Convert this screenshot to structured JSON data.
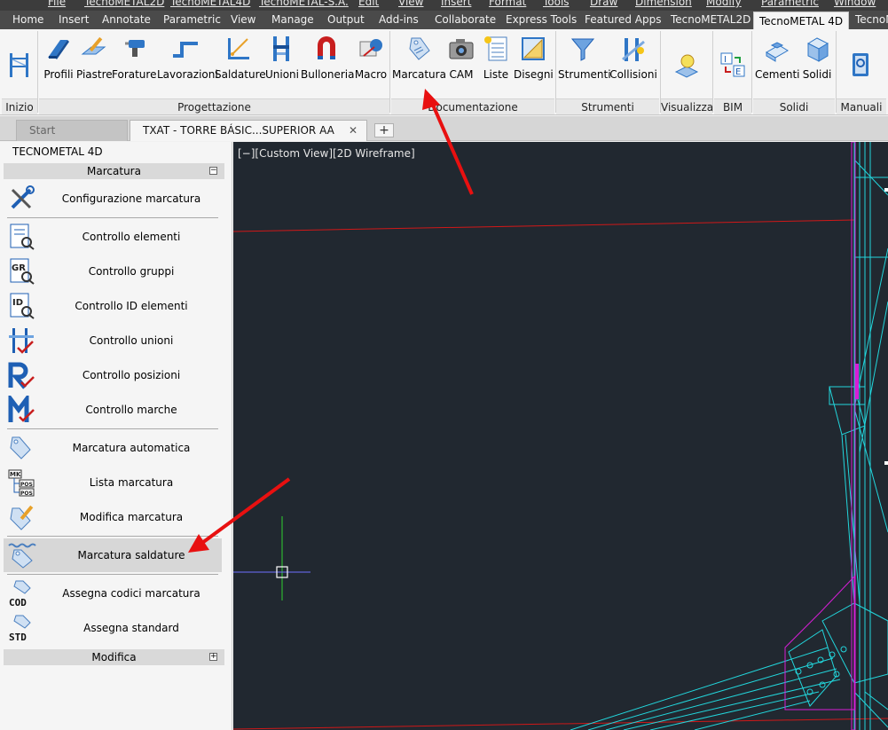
{
  "menubar": [
    "File",
    "TecnoMETAL2D",
    "TecnoMETAL4D",
    "TecnoMETAL-S.A.",
    "Edit",
    "View",
    "Insert",
    "Format",
    "Tools",
    "Draw",
    "Dimension",
    "Modify",
    "Parametric",
    "Window"
  ],
  "ribbon_tabs": [
    "Home",
    "Insert",
    "Annotate",
    "Parametric",
    "View",
    "Manage",
    "Output",
    "Add-ins",
    "Collaborate",
    "Express Tools",
    "Featured Apps",
    "TecnoMETAL2D",
    "TecnoMETAL 4D",
    "TecnoM"
  ],
  "ribbon_active_tab": "TecnoMETAL 4D",
  "ribbon_buttons": {
    "profili": "Profili",
    "piastre": "Piastre",
    "forature": "Forature",
    "lavorazioni": "Lavorazioni",
    "saldature": "Saldature",
    "unioni": "Unioni",
    "bulloneria": "Bulloneria",
    "macro": "Macro",
    "marcatura": "Marcatura",
    "cam": "CAM",
    "liste": "Liste",
    "disegni": "Disegni",
    "strumenti": "Strumenti",
    "collisioni": "Collisioni",
    "cementi": "Cementi",
    "solidi": "Solidi"
  },
  "ribbon_groups": {
    "inizio": "Inizio",
    "progettazione": "Progettazione",
    "documentazione": "Documentazione",
    "strumenti": "Strumenti",
    "visualizza": "Visualizza",
    "bim": "BIM",
    "solidi": "Solidi",
    "manuali": "Manuali"
  },
  "doc_tabs": {
    "start": "Start",
    "document": "TXAT - TORRE BÁSIC...SUPERIOR AA ACAD*",
    "close": "✕",
    "add": "+"
  },
  "palette": {
    "title": "TECNOMETAL 4D",
    "section_marcatura": "Marcatura",
    "section_marcatura_toggle": "−",
    "section_modifica": "Modifica",
    "section_modifica_toggle": "+",
    "items": {
      "configurazione": "Configurazione marcatura",
      "controllo_elementi": "Controllo elementi",
      "controllo_gruppi": "Controllo gruppi",
      "controllo_id": "Controllo ID elementi",
      "controllo_unioni": "Controllo unioni",
      "controllo_posizioni": "Controllo posizioni",
      "controllo_marche": "Controllo marche",
      "marcatura_automatica": "Marcatura automatica",
      "lista_marcatura": "Lista marcatura",
      "modifica_marcatura": "Modifica marcatura",
      "marcatura_saldature": "Marcatura saldature",
      "assegna_codici": "Assegna codici marcatura",
      "assegna_standard": "Assegna standard"
    },
    "icon_text": {
      "gr": "GR",
      "id": "ID",
      "mk": "MK",
      "pos": "POS",
      "cod": "COD",
      "std": "STD"
    }
  },
  "viewport": {
    "label": "[−][Custom View][2D Wireframe]"
  },
  "colors": {
    "canvas_bg": "#212830",
    "annotation_arrow": "#e81010",
    "wire_cyan": "#22d6dc",
    "wire_magenta": "#d61ed6",
    "accent_blue": "#1e5fb4"
  }
}
